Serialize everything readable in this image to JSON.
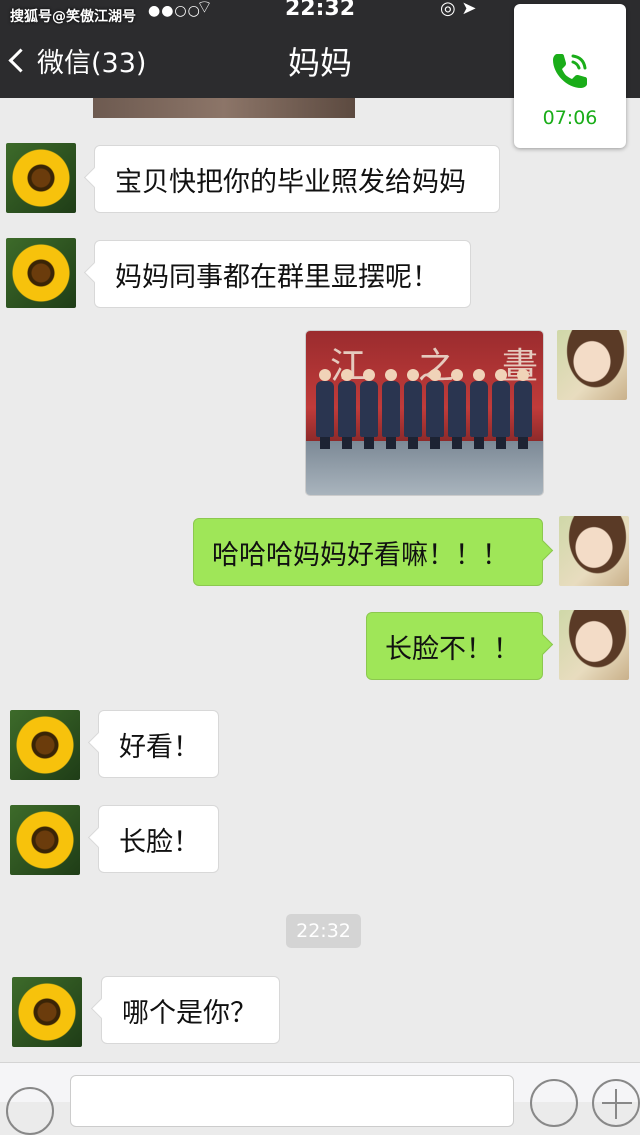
{
  "status_bar": {
    "watermark": "搜狐号@笑傲江湖号",
    "time": "22:32"
  },
  "header": {
    "back_label": "微信(33)",
    "title": "妈妈"
  },
  "call_widget": {
    "duration": "07:06",
    "accent_color": "#1aad19"
  },
  "messages": [
    {
      "side": "left",
      "text": "宝贝快把你的毕业照发给妈妈",
      "avatar": "sunflower-avatar"
    },
    {
      "side": "left",
      "text": "妈妈同事都在群里显摆呢！",
      "avatar": "sunflower-avatar"
    },
    {
      "side": "right",
      "type": "image",
      "avatar": "girl-avatar"
    },
    {
      "side": "right",
      "text": "哈哈哈妈妈好看嘛！！！",
      "avatar": "girl-avatar"
    },
    {
      "side": "right",
      "text": "长脸不！！",
      "avatar": "girl-avatar"
    },
    {
      "side": "left",
      "text": "好看！",
      "avatar": "sunflower-avatar"
    },
    {
      "side": "left",
      "text": "长脸！",
      "avatar": "sunflower-avatar"
    },
    {
      "side": "left",
      "text": "哪个是你？",
      "avatar": "sunflower-avatar"
    }
  ],
  "timestamp": "22:32",
  "colors": {
    "sent_bubble": "#9fe658",
    "received_bubble": "#ffffff",
    "header_bg": "#2c2c2e",
    "chat_bg": "#ebebeb"
  }
}
